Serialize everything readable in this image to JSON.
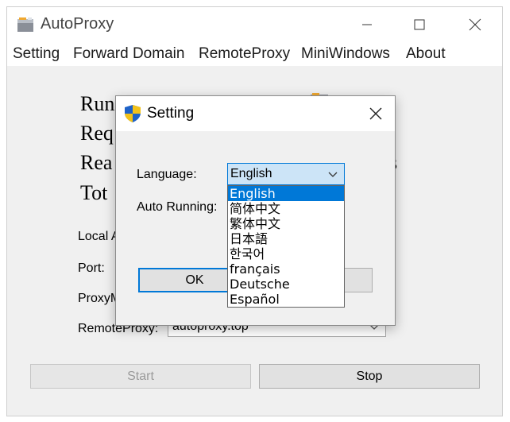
{
  "window": {
    "title": "AutoProxy",
    "menu": [
      "Setting",
      "Forward Domain",
      "RemoteProxy",
      "MiniWindows",
      "About"
    ]
  },
  "main": {
    "stats": [
      "Running S",
      "Req",
      "Rea",
      "Tot"
    ],
    "stats_right_fragment": "s",
    "labels": {
      "local": "Local A",
      "port": "Port:",
      "proxymode": "ProxyM",
      "remoteproxy": "RemoteProxy:"
    },
    "remoteproxy_value": "autoproxy.top",
    "start_label": "Start",
    "stop_label": "Stop"
  },
  "dialog": {
    "title": "Setting",
    "language_label": "Language:",
    "language_value": "English",
    "autorun_label": "Auto Running:",
    "ok_label": "OK",
    "language_options": [
      "English",
      "简体中文",
      "繁体中文",
      "日本語",
      "한국어",
      "français",
      "Deutsche",
      "Español"
    ],
    "selected_index": 0
  },
  "colors": {
    "accent": "#0078d7",
    "combo_focus_bg": "#cce4f7",
    "window_bg": "#f0f0f0"
  }
}
